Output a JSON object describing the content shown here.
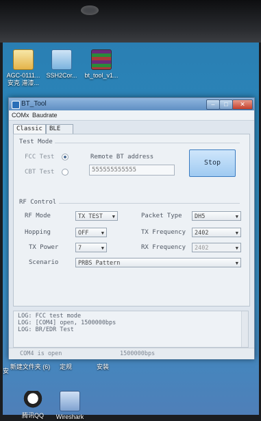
{
  "desktop": {
    "icons": [
      {
        "label": "AGC-0111... 安克 滞漆...",
        "icon": "document-icon"
      },
      {
        "label": "SSH2Cor...",
        "icon": "terminal-icon"
      },
      {
        "label": "bt_tool_v1...",
        "icon": "archive-icon"
      },
      {
        "label": "新建文件夹 (6)",
        "icon": "folder-icon"
      },
      {
        "label": "定规",
        "icon": "app-icon"
      },
      {
        "label": "安装",
        "icon": "app-icon"
      },
      {
        "label": "腾讯QQ",
        "icon": "qq-icon"
      },
      {
        "label": "Wireshark",
        "icon": "app-icon"
      }
    ],
    "left_edge_label": "安"
  },
  "window": {
    "title": "BT_Tool",
    "menu": [
      "COMx",
      "Baudrate"
    ],
    "tabs": [
      {
        "label": "Classic",
        "active": true
      },
      {
        "label": "BLE",
        "active": false
      }
    ],
    "test_mode": {
      "heading": "Test Mode",
      "fcc_label": "FCC Test",
      "cbt_label": "CBT Test",
      "selected": "FCC Test",
      "remote_label": "Remote BT address",
      "remote_value": "555555555555",
      "stop_label": "Stop"
    },
    "rf_control": {
      "heading": "RF Control",
      "rf_mode_label": "RF Mode",
      "rf_mode_value": "TX TEST",
      "hopping_label": "Hopping",
      "hopping_value": "OFF",
      "tx_power_label": "TX Power",
      "tx_power_value": "7",
      "scenario_label": "Scenario",
      "scenario_value": "PRBS Pattern",
      "packet_type_label": "Packet Type",
      "packet_type_value": "DH5",
      "tx_freq_label": "TX Frequency",
      "tx_freq_value": "2402",
      "rx_freq_label": "RX Frequency",
      "rx_freq_value": "2402"
    },
    "log_lines": [
      "LOG: FCC test mode",
      "LOG: [COM4] open, 1500000bps",
      "LOG: BR/EDR Test"
    ],
    "status": {
      "port": "COM4 is open",
      "baud": "1500000bps"
    }
  }
}
